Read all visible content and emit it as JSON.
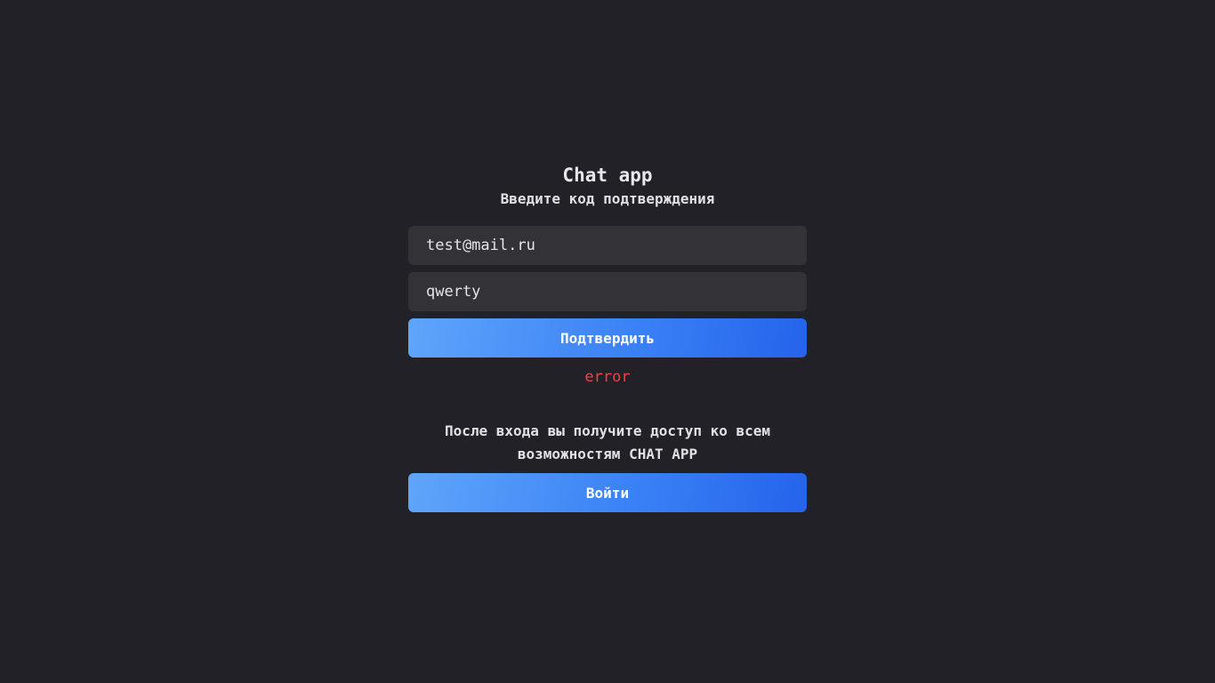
{
  "app": {
    "title": "Chat app",
    "subtitle": "Введите код подтверждения"
  },
  "form": {
    "email_value": "test@mail.ru",
    "code_value": "qwerty",
    "confirm_label": "Подтвердить",
    "error_text": "error"
  },
  "footer": {
    "info_text": "После входа вы получите доступ ко всем возможностям CHAT APP",
    "login_label": "Войти"
  },
  "colors": {
    "background": "#222127",
    "input_bg": "#333236",
    "accent_start": "#60a5fa",
    "accent_end": "#2563eb",
    "error": "#ef4444"
  }
}
